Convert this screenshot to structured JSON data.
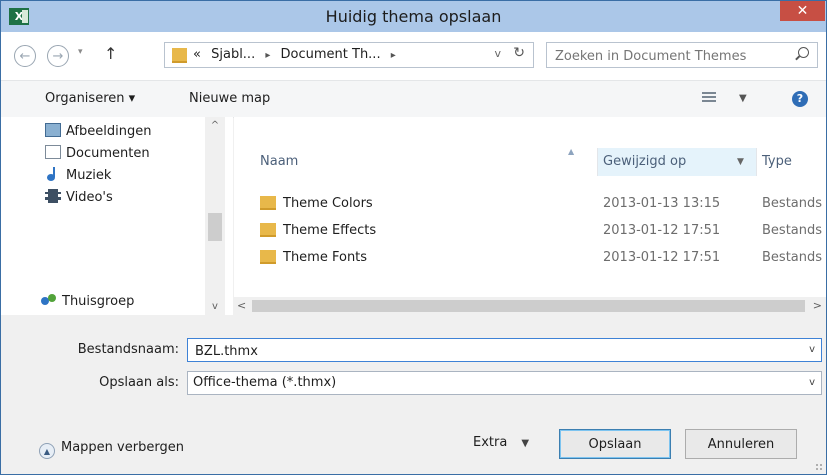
{
  "window": {
    "title": "Huidig thema opslaan",
    "app_icon_label": "X",
    "close_label": "✕"
  },
  "nav": {
    "back_label": "←",
    "forward_label": "→",
    "recent_label": "▾",
    "up_label": "↑",
    "address": {
      "prefix": "«",
      "segments": [
        "Sjabl...",
        "Document Th..."
      ],
      "separator": "▸",
      "dropdown_label": "v",
      "refresh_label": "↻"
    },
    "search": {
      "placeholder": "Zoeken in Document Themes"
    }
  },
  "toolbar": {
    "organize_label": "Organiseren ▾",
    "new_folder_label": "Nieuwe map",
    "view_dropdown": "▼",
    "help_label": "?"
  },
  "sidebar": {
    "items": [
      {
        "label": "Afbeeldingen",
        "icon": "pictures-icon"
      },
      {
        "label": "Documenten",
        "icon": "documents-icon"
      },
      {
        "label": "Muziek",
        "icon": "music-icon"
      },
      {
        "label": "Video's",
        "icon": "video-icon"
      },
      {
        "label": "Thuisgroep",
        "icon": "homegroup-icon"
      }
    ],
    "scroll_up": "^",
    "scroll_down": "v"
  },
  "files": {
    "columns": {
      "name": "Naam",
      "modified": "Gewijzigd op",
      "type": "Type"
    },
    "column_dropdown": "▼",
    "sort_arrow": "▲",
    "rows": [
      {
        "name": "Theme Colors",
        "modified": "2013-01-13 13:15",
        "type": "Bestands"
      },
      {
        "name": "Theme Effects",
        "modified": "2013-01-12 17:51",
        "type": "Bestands"
      },
      {
        "name": "Theme Fonts",
        "modified": "2013-01-12 17:51",
        "type": "Bestands"
      }
    ],
    "scroll_left": "<",
    "scroll_right": ">"
  },
  "form": {
    "filename_label": "Bestandsnaam:",
    "filename_value": "BZL.thmx",
    "savetype_label": "Opslaan als:",
    "savetype_value": "Office-thema (*.thmx)",
    "dropdown_label": "v"
  },
  "footer": {
    "hide_folders_label": "Mappen verbergen",
    "hide_folders_icon": "▲",
    "extra_label": "Extra",
    "extra_dropdown": "▼",
    "save_label": "Opslaan",
    "cancel_label": "Annuleren"
  },
  "colors": {
    "titlebar": "#abc7e8",
    "close": "#c74f44",
    "folder": "#e8b84a",
    "accent": "#3e82d6"
  }
}
